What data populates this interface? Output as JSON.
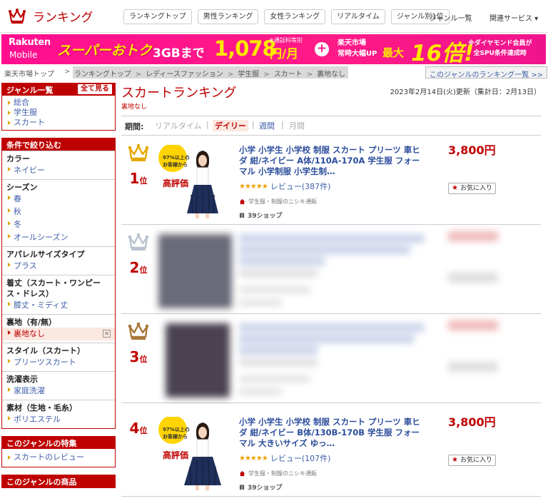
{
  "header": {
    "logo_text": "ランキング",
    "tabs": [
      "ランキングトップ",
      "男性ランキング",
      "女性ランキング",
      "リアルタイム",
      "ジャンル別1位"
    ],
    "links": [
      "ジャンル一覧",
      "関連サービス ▾"
    ]
  },
  "banner": {
    "brand1": "Rakuten",
    "brand2": "Mobile",
    "campaign": "スーパーおトク",
    "gb": "3GBまで",
    "note1": "※通話料等別",
    "price": "1,078",
    "unit": "円/月",
    "plus": "+",
    "ichiba1": "楽天市場",
    "ichiba2": "常時大幅UP",
    "max": "最大",
    "multiplier": "16倍!",
    "note2a": "※ダイヤモンド会員が",
    "note2b": "全SPU条件達成時"
  },
  "breadcrumb": {
    "top": "楽天市場トップ",
    "items": [
      "ランキングトップ",
      "レディースファッション",
      "学生服",
      "スカート",
      "裏地なし"
    ],
    "genre_link": "このジャンルのランキング一覧 >>"
  },
  "sidebar": {
    "genre_title": "ジャンル一覧",
    "see_all": "全て見る",
    "genres": [
      "総合",
      "学生服",
      "スカート"
    ],
    "filter_title": "条件で絞り込む",
    "filters": [
      {
        "title": "カラー",
        "items": [
          "ネイビー"
        ]
      },
      {
        "title": "シーズン",
        "items": [
          "春",
          "秋",
          "冬",
          "オールシーズン"
        ]
      },
      {
        "title": "アパレルサイズタイプ",
        "items": [
          "プラス"
        ]
      },
      {
        "title": "着丈（スカート・ワンピース・ドレス）",
        "items": [
          "膝丈・ミディ丈"
        ]
      },
      {
        "title": "裏地（有/無）",
        "items": [
          "裏地なし"
        ],
        "active": "裏地なし"
      },
      {
        "title": "スタイル（スカート）",
        "items": [
          "プリーツスカート"
        ]
      },
      {
        "title": "洗濯表示",
        "items": [
          "家庭洗濯"
        ]
      },
      {
        "title": "素材（生地・毛糸）",
        "items": [
          "ポリエステル"
        ]
      }
    ],
    "feature_title": "このジャンルの特集",
    "feature_link": "スカートのレビュー",
    "goods_title": "このジャンルの商品"
  },
  "main": {
    "title": "スカートランキング",
    "subtag": "裏地なし",
    "updated": "2023年2月14日(火)更新（集計日：2月13日）",
    "period_label": "期間:",
    "period_tabs": [
      "リアルタイム",
      "デイリー",
      "週間",
      "月間"
    ],
    "period_active": "デイリー"
  },
  "items": [
    {
      "rank": "1",
      "rank_suffix": "位",
      "name": "小学 小学生 小学校 制服 スカート プリーツ 車ヒダ 紺/ネイビー A体/110A-170A 学生服 フォーマル 小学制服 小学生制…",
      "price": "3,800円",
      "stars": "★★★★★",
      "review": "レビュー(387件)",
      "shop": "学生服・制服のニシキ通販",
      "shops": "39ショップ",
      "fav": "お気に入り",
      "thumb_text1": "97%以上の",
      "thumb_text2": "お客様から",
      "thumb_text3": "高評価"
    },
    {
      "rank": "4",
      "rank_suffix": "位",
      "name": "小学 小学生 小学校 制服 スカート プリーツ 車ヒダ 紺/ネイビー B体/130B-170B 学生服 フォーマル 大きいサイズ ゆっ…",
      "price": "3,800円",
      "stars": "★★★★★",
      "review": "レビュー(107件)",
      "shop": "学生服・制服のニシキ通販",
      "shops": "39ショップ",
      "fav": "お気に入り",
      "thumb_text1": "97%以上の",
      "thumb_text2": "お客様から",
      "thumb_text3": "高評価"
    }
  ],
  "blurred_ranks": [
    {
      "rank": "2",
      "rank_suffix": "位"
    },
    {
      "rank": "3",
      "rank_suffix": "位"
    }
  ],
  "colors": {
    "brand_red": "#bf0000",
    "link_blue": "#3d5ea8",
    "banner_pink": "#ff1a87",
    "banner_yellow": "#ffe800"
  }
}
